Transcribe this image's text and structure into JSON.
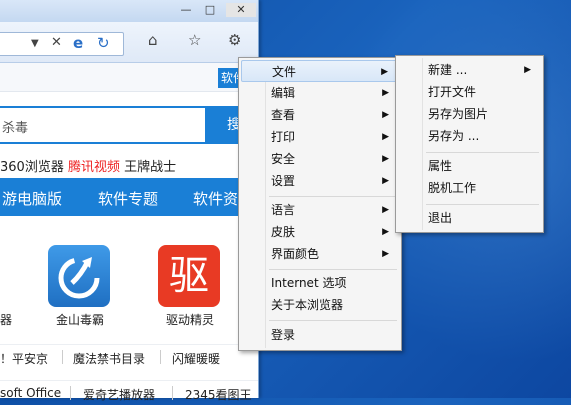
{
  "browser": {
    "title_buttons": {
      "minimize": "—",
      "maximize": "□",
      "close": "✕"
    },
    "soft_tag": "软件",
    "search": {
      "text": "杀毒",
      "button": "搜"
    },
    "hot_links": [
      {
        "text": "360浏览器",
        "color": "#222222"
      },
      {
        "text": "腾讯视频",
        "color": "#e02222"
      },
      {
        "text": "王牌战士",
        "color": "#222222"
      }
    ],
    "nav": [
      "游电脑版",
      "软件专题",
      "软件资"
    ],
    "apps": [
      {
        "label": "器"
      },
      {
        "label": "金山毒霸"
      },
      {
        "label": "驱动精灵",
        "glyph": "驱"
      }
    ],
    "links_row1": [
      "！平安京",
      "魔法禁书目录",
      "闪耀暖暖"
    ],
    "links_row2": [
      "soft Office",
      "爱奇艺播放器",
      "2345看图王"
    ]
  },
  "main_menu": {
    "items": [
      {
        "label": "文件",
        "submenu": true
      },
      {
        "label": "编辑",
        "submenu": true
      },
      {
        "label": "查看",
        "submenu": true
      },
      {
        "label": "打印",
        "submenu": true
      },
      {
        "label": "安全",
        "submenu": true
      },
      {
        "label": "设置",
        "submenu": true
      },
      {
        "label": "语言",
        "submenu": true
      },
      {
        "label": "皮肤",
        "submenu": true
      },
      {
        "label": "界面颜色",
        "submenu": true
      },
      {
        "label": "Internet 选项",
        "submenu": false
      },
      {
        "label": "关于本浏览器",
        "submenu": false
      },
      {
        "label": "登录",
        "submenu": false
      }
    ]
  },
  "file_submenu": {
    "items": [
      {
        "label": "新建 ...",
        "submenu": true
      },
      {
        "label": "打开文件",
        "submenu": false
      },
      {
        "label": "另存为图片",
        "submenu": false
      },
      {
        "label": "另存为 ...",
        "submenu": false
      },
      {
        "label": "属性",
        "submenu": false
      },
      {
        "label": "脱机工作",
        "submenu": false
      },
      {
        "label": "退出",
        "submenu": false
      }
    ]
  },
  "colors": {
    "accent": "#1a7fd6",
    "desktop": "#1a63bd",
    "hot_red": "#e02222"
  }
}
